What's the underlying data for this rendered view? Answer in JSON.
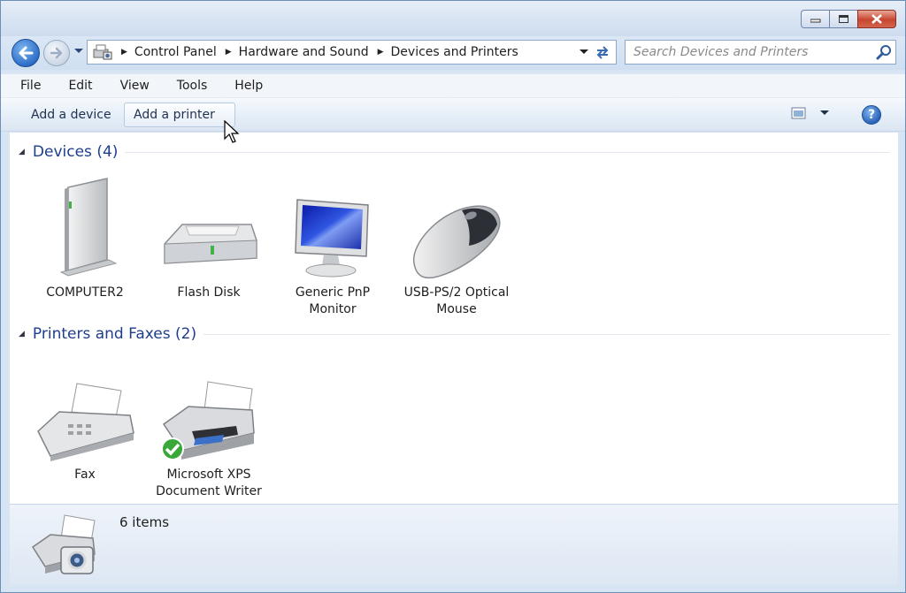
{
  "window": {
    "minimize_icon": "minimize-icon",
    "maximize_icon": "maximize-icon",
    "close_icon": "close-icon"
  },
  "address": {
    "crumbs": [
      "Control Panel",
      "Hardware and Sound",
      "Devices and Printers"
    ]
  },
  "search": {
    "placeholder": "Search Devices and Printers"
  },
  "menu": {
    "items": [
      "File",
      "Edit",
      "View",
      "Tools",
      "Help"
    ]
  },
  "commands": {
    "add_device": "Add a device",
    "add_printer": "Add a printer",
    "help_glyph": "?"
  },
  "groups": [
    {
      "title": "Devices (4)",
      "items": [
        {
          "label": "COMPUTER2",
          "icon": "computer-icon"
        },
        {
          "label": "Flash Disk",
          "icon": "flash-disk-icon"
        },
        {
          "label": "Generic PnP Monitor",
          "icon": "monitor-icon"
        },
        {
          "label": "USB-PS/2 Optical Mouse",
          "icon": "mouse-icon"
        }
      ]
    },
    {
      "title": "Printers and Faxes (2)",
      "items": [
        {
          "label": "Fax",
          "icon": "fax-icon"
        },
        {
          "label": "Microsoft XPS Document Writer",
          "icon": "printer-icon",
          "default": true
        }
      ]
    }
  ],
  "details": {
    "count": "6 items"
  },
  "colors": {
    "group_title": "#1e3d8c",
    "accent": "#2d6ec8",
    "default_badge": "#3aa838"
  }
}
